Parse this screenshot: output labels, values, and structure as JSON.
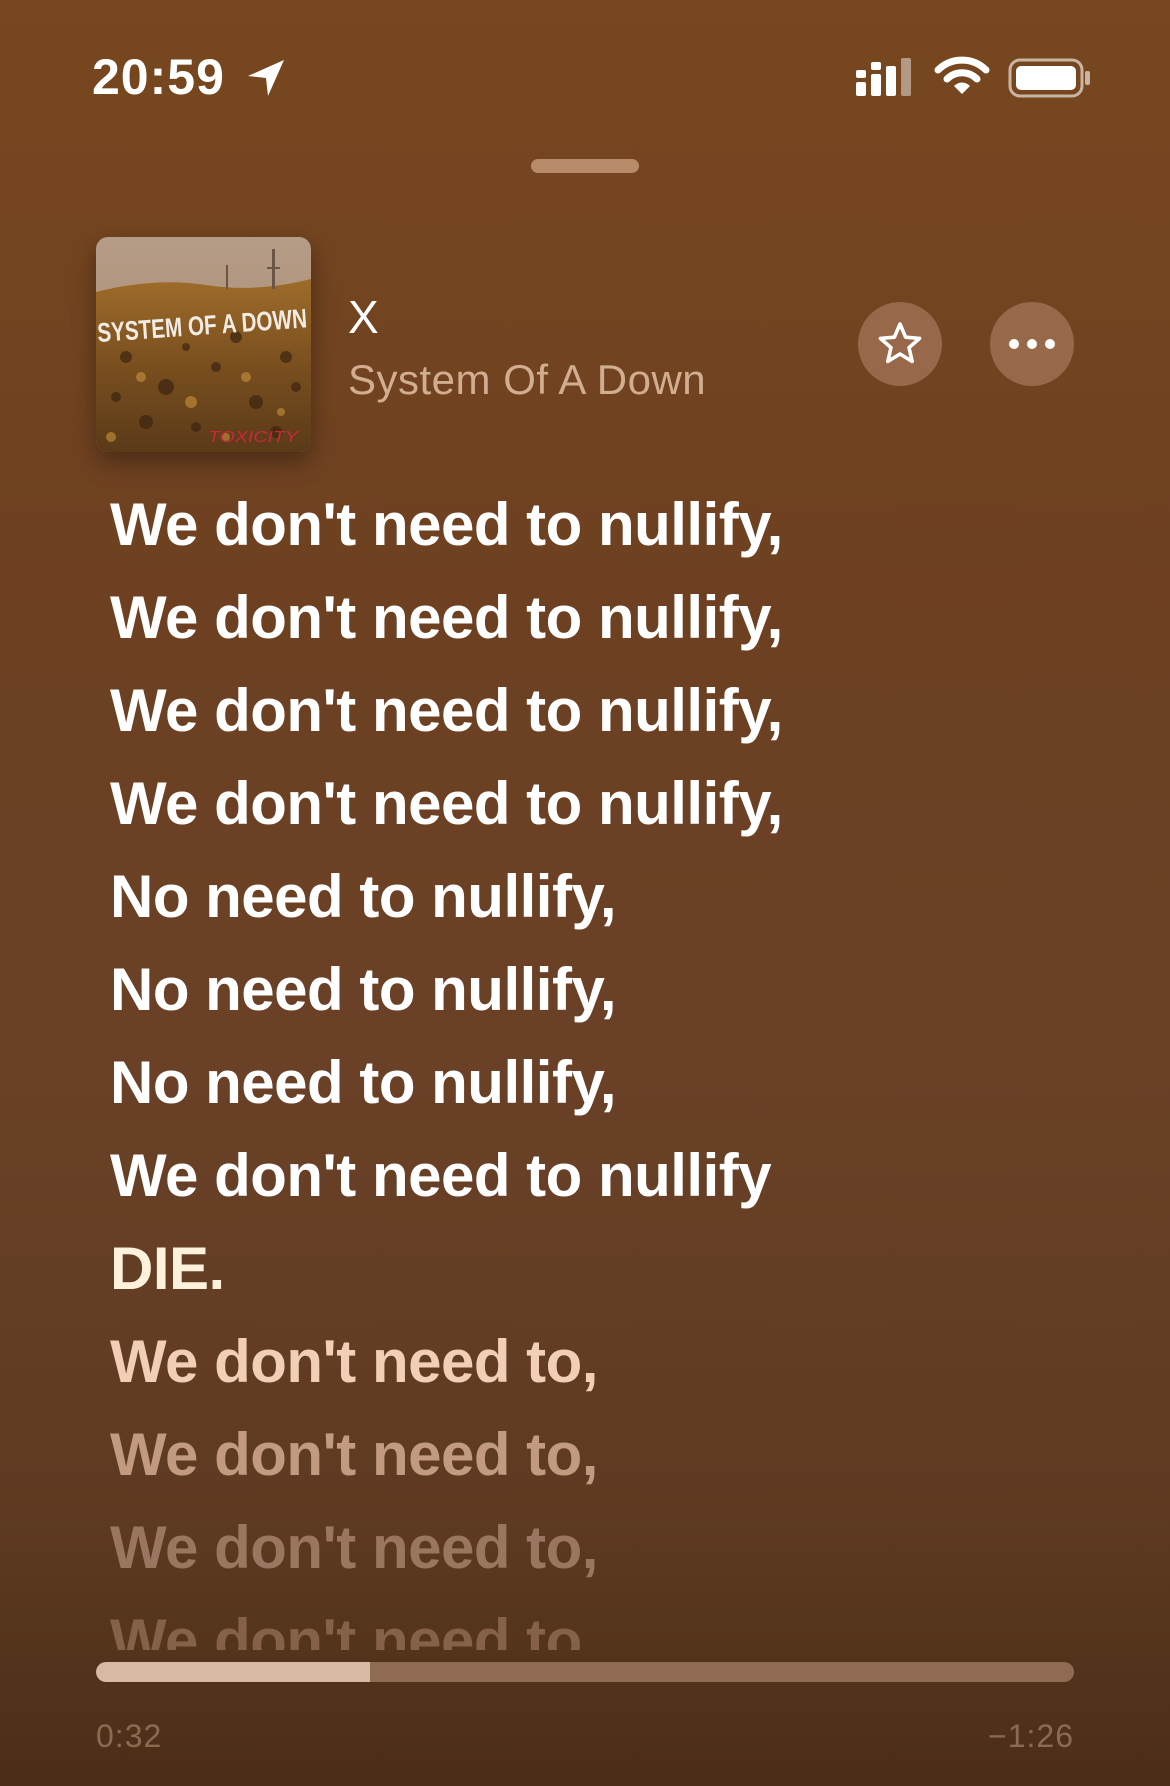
{
  "status_bar": {
    "time": "20:59",
    "icons": [
      "location-arrow-icon",
      "cellular-signal-icon",
      "wifi-icon",
      "battery-icon"
    ]
  },
  "now_playing": {
    "title": "X",
    "artist": "System Of A Down",
    "artwork": {
      "band_text": "SYSTEM OF A DOWN",
      "album_text": "TOXICITY"
    }
  },
  "actions": {
    "favorite_icon": "star-icon",
    "more_icon": "ellipsis-icon"
  },
  "lyrics": [
    "We don't need to nullify,",
    "We don't need to nullify,",
    "We don't need to nullify,",
    "We don't need to nullify,",
    "No need to nullify,",
    "No need to nullify,",
    "No need to nullify,",
    "We don't need to nullify",
    "DIE.",
    "We don't need to,",
    "We don't need to,",
    "We don't need to,",
    "We don't need to,"
  ],
  "playback": {
    "elapsed": "0:32",
    "remaining": "−1:26",
    "progress_fraction": 0.28
  },
  "colors": {
    "background_top": "#77471f",
    "background_bottom": "#4c2d17",
    "artist_text": "#d1ae90",
    "button_bg": "#97694a",
    "progress_fill": "#d8b9a2",
    "progress_track": "#8f6b53"
  }
}
